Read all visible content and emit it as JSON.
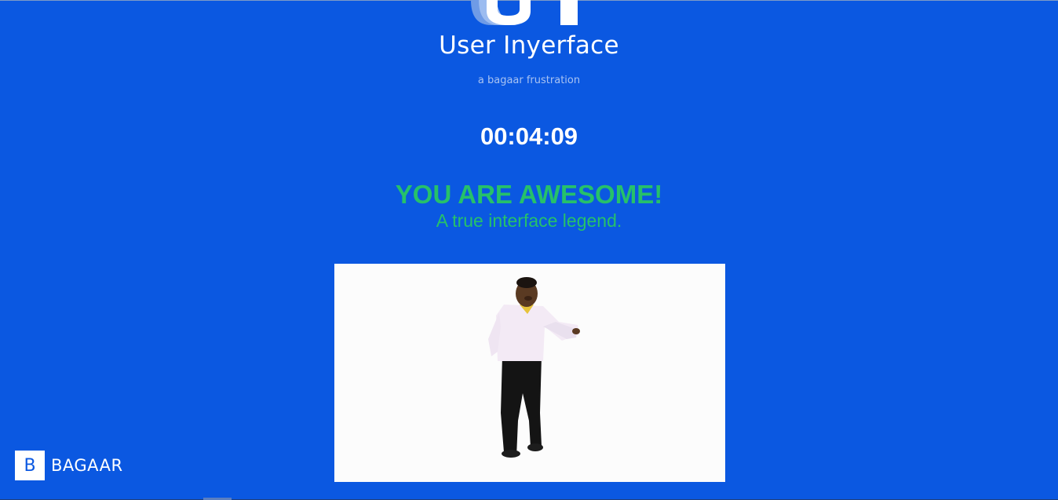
{
  "header": {
    "title": "User Inyerface",
    "subtitle": "a bagaar frustration",
    "logo_icon": "ui-logo-icon"
  },
  "timer": {
    "value": "00:04:09"
  },
  "result": {
    "headline": "YOU ARE AWESOME!",
    "subline": "A true interface legend."
  },
  "media": {
    "icon": "dancing-man-gif"
  },
  "brand": {
    "box_letter": "B",
    "name": "BAGAAR"
  },
  "colors": {
    "background": "#0b58e1",
    "success": "#26c16a",
    "text": "#ffffff",
    "subtitle": "#a9c3f2"
  }
}
